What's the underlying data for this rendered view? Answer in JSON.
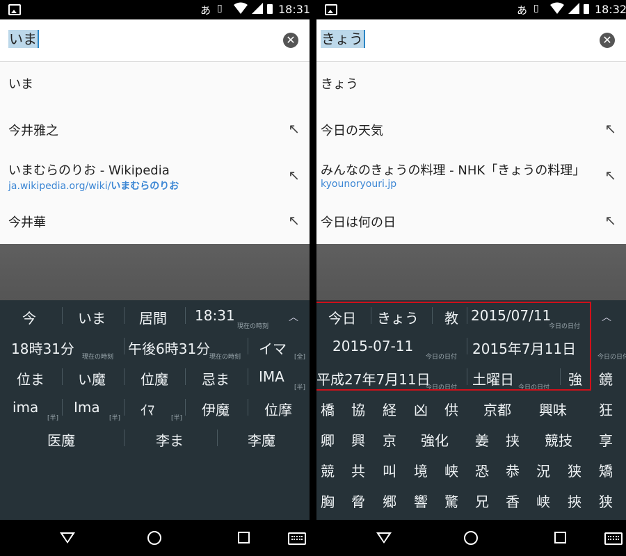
{
  "left": {
    "status": {
      "ime": "あ",
      "time": "18:31"
    },
    "search": {
      "query": "いま"
    },
    "suggestions": [
      {
        "title": "いま"
      },
      {
        "title": "今井雅之"
      },
      {
        "title": "いまむらのりお - Wikipedia",
        "url_prefix": "ja.wikipedia.org/wiki/",
        "url_bold": "いまむらのりお"
      },
      {
        "title": "今井華"
      }
    ],
    "candidates": {
      "c1": "今",
      "c2": "いま",
      "c3": "居間",
      "c4": "18:31",
      "t4": "現在の時刻",
      "c5": "18時31分",
      "t5": "現在の時刻",
      "c6": "午後6時31分",
      "t6": "現在の時刻",
      "c7": "イマ",
      "t7": "[全]",
      "c8": "位ま",
      "c9": "い魔",
      "c10": "位魔",
      "c11": "忌ま",
      "c12": "IMA",
      "t12": "[半]",
      "c13": "ima",
      "t13": "[半]",
      "c14": "Ima",
      "t14": "[半]",
      "c15": "ｲﾏ",
      "t15": "[半]",
      "c16": "伊魔",
      "c17": "位摩",
      "c18": "医魔",
      "c19": "李ま",
      "c20": "李魔"
    }
  },
  "right": {
    "status": {
      "ime": "あ",
      "time": "18:32"
    },
    "search": {
      "query": "きょう"
    },
    "suggestions": [
      {
        "title": "きょう"
      },
      {
        "title": "今日の天気"
      },
      {
        "title": "みんなのきょうの料理 - NHK「きょうの料理」",
        "url": "kyounoryouri.jp"
      },
      {
        "title": "今日は何の日"
      }
    ],
    "candidates": {
      "c1": "今日",
      "c2": "きょう",
      "c3": "教",
      "c4": "2015/07/11",
      "t4": "今日の日付",
      "c5": "2015-07-11",
      "t5": "今日の日付",
      "c6": "2015年7月11日",
      "t6": "今日の日付",
      "c7": "平成27年7月11日",
      "t7": "今日の日付",
      "c8": "土曜日",
      "t8": "今日の日付",
      "c9": "強",
      "c10": "鏡",
      "grid": [
        [
          "橋",
          "協",
          "経",
          "凶",
          "供",
          "京都",
          "興味",
          "狂"
        ],
        [
          "卿",
          "興",
          "京",
          "強化",
          "姜",
          "挟",
          "競技",
          "享"
        ],
        [
          "競",
          "共",
          "叫",
          "境",
          "峡",
          "恐",
          "恭",
          "況",
          "狭",
          "矯"
        ],
        [
          "胸",
          "脅",
          "郷",
          "響",
          "驚",
          "兄",
          "香",
          "峡",
          "挾",
          "狭"
        ]
      ]
    }
  }
}
